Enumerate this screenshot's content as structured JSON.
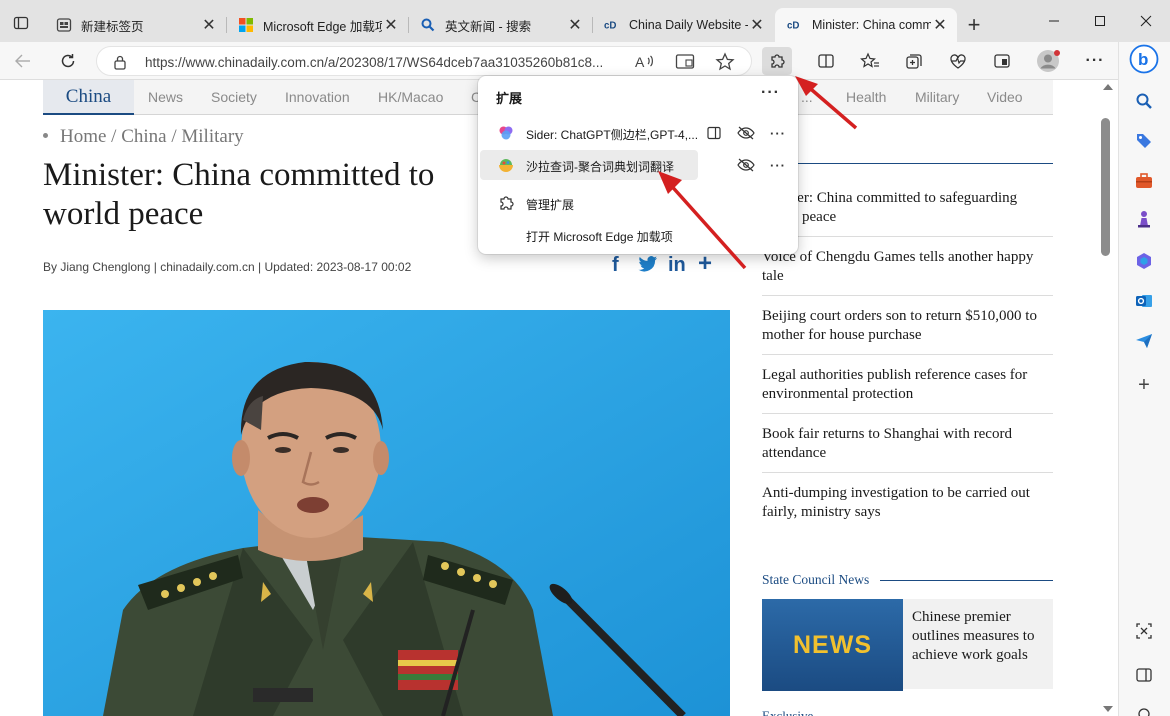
{
  "tabs": [
    {
      "title": "新建标签页",
      "favicon": "new-tab-favicon"
    },
    {
      "title": "Microsoft Edge 加载项",
      "favicon": "microsoft-favicon"
    },
    {
      "title": "英文新闻 - 搜索",
      "favicon": "search-favicon"
    },
    {
      "title": "China Daily Website -",
      "favicon": "chinadaily-favicon"
    },
    {
      "title": "Minister: China comm",
      "favicon": "chinadaily-favicon",
      "active": true
    }
  ],
  "address_bar": {
    "url": "https://www.chinadaily.com.cn/a/202308/17/WS64dceb7aa31035260b81c8..."
  },
  "site_nav": {
    "logo": "China",
    "items": [
      "News",
      "Society",
      "Innovation",
      "HK/Macao",
      "C",
      "...",
      "Health",
      "Military",
      "Video"
    ]
  },
  "article": {
    "breadcrumb": "Home / China / Military",
    "headline": "Minister: China committed to safeguarding world peace",
    "headline_visible_line1": "Minister: China committed to",
    "headline_visible_line2": "world peace",
    "byline": "By Jiang Chenglong | chinadaily.com.cn | Updated: 2023-08-17 00:02",
    "share_icons": [
      "facebook-icon",
      "twitter-icon",
      "linkedin-icon",
      "more-share-icon"
    ]
  },
  "right_column": {
    "headlines": [
      "Minister: China committed to safeguarding world peace",
      "Voice of Chengdu Games tells another happy tale",
      "Beijing court orders son to return $510,000 to mother for house purchase",
      "Legal authorities publish reference cases for environmental protection",
      "Book fair returns to Shanghai with record attendance",
      "Anti-dumping investigation to be carried out fairly, ministry says"
    ],
    "first_headline_visible": "ter: China committed to safeguarding",
    "first_headline_visible_line2": "peace",
    "section_title": "State Council News",
    "section_card": {
      "image_text": "NEWS",
      "text": "Chinese premier outlines measures to achieve work goals"
    },
    "next_section": "Exclusive"
  },
  "extensions_popup": {
    "title": "扩展",
    "items": [
      {
        "name": "Sider: ChatGPT侧边栏,GPT-4,...",
        "icon": "sider-icon"
      },
      {
        "name": "沙拉查词-聚合词典划词翻译",
        "icon": "saladict-icon",
        "highlighted": true
      }
    ],
    "manage_label": "管理扩展",
    "open_addons_label": "打开 Microsoft Edge 加载项"
  },
  "colors": {
    "accent": "#1b4b82",
    "arrow": "#e02020",
    "photo_bg": "#2aa6e6"
  }
}
